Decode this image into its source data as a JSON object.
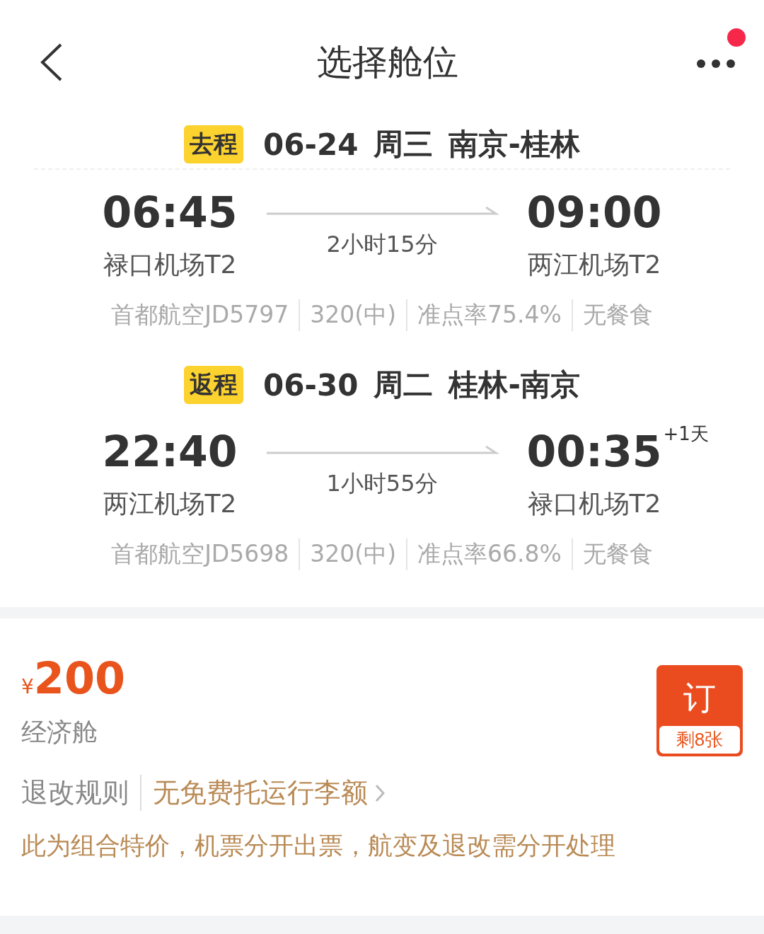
{
  "header": {
    "title": "选择舱位",
    "notification": true
  },
  "legs": [
    {
      "tag": "去程",
      "date": "06-24",
      "weekday": "周三",
      "route": "南京-桂林",
      "depart_time": "06:45",
      "depart_airport": "禄口机场T2",
      "duration": "2小时15分",
      "arrive_time": "09:00",
      "arrive_airport": "两江机场T2",
      "details": [
        "首都航空JD5797",
        "320(中)",
        "准点率75.4%",
        "无餐食"
      ]
    },
    {
      "tag": "返程",
      "date": "06-30",
      "weekday": "周二",
      "route": "桂林-南京",
      "depart_time": "22:40",
      "depart_airport": "两江机场T2",
      "duration": "1小时55分",
      "arrive_time": "00:35",
      "day_offset": "+1天",
      "arrive_airport": "禄口机场T2",
      "details": [
        "首都航空JD5698",
        "320(中)",
        "准点率66.8%",
        "无餐食"
      ]
    }
  ],
  "fare": {
    "currency": "¥",
    "price": "200",
    "cabin": "经济舱",
    "rules": "退改规则",
    "baggage": "无免费托运行李额",
    "note": "此为组合特价，机票分开出票，航变及退改需分开处理",
    "book": "订",
    "remaining": "剩8张"
  }
}
